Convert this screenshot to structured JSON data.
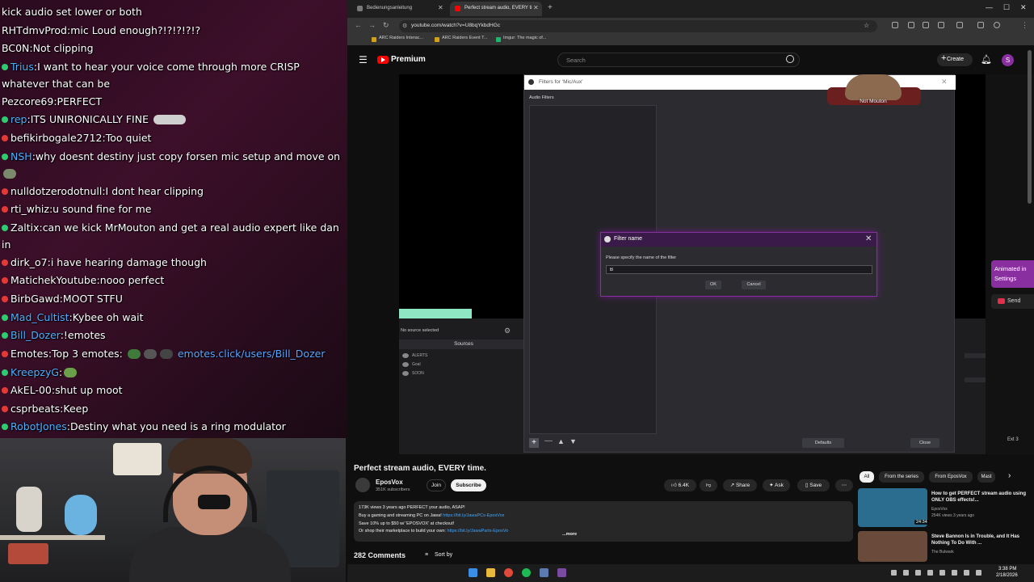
{
  "chat": {
    "lines": [
      {
        "user": "",
        "text": "kick audio set lower or both"
      },
      {
        "user": "RHTdmvProd",
        "text": "mic Loud enough?!?!?!?!?"
      },
      {
        "user": "BC0N",
        "text": "Not clipping"
      },
      {
        "user": "Trius",
        "text": "I want to hear your voice come through more CRISP whatever that can be"
      },
      {
        "user": "Pezcore69",
        "text": "PERFECT"
      },
      {
        "user": "rep",
        "text": "ITS UNIRONICALLY FINE"
      },
      {
        "user": "befikirbogale2712",
        "text": "Too quiet"
      },
      {
        "user": "NSH",
        "text": "why doesnt destiny just copy forsen mic setup and move on"
      },
      {
        "user": "nulldotzerodotnull",
        "text": "I dont hear clipping"
      },
      {
        "user": "rti_whiz",
        "text": "u sound fine for me"
      },
      {
        "user": "Zaltix",
        "text": "can we kick MrMouton and get a real audio expert like dan in"
      },
      {
        "user": "dirk_o7",
        "text": "i have hearing damage though"
      },
      {
        "user": "MatichekYoutube",
        "text": "nooo perfect"
      },
      {
        "user": "BirbGawd",
        "text": "MOOT STFU"
      },
      {
        "user": "Mad_Cultist",
        "text": "Kybee oh wait"
      },
      {
        "user": "Bill_Dozer",
        "text": "!emotes"
      },
      {
        "user": "Emotes",
        "text": "Top 3 emotes:",
        "link": "emotes.click/users/Bill_Dozer"
      },
      {
        "user": "KreepzyG",
        "text": ""
      },
      {
        "user": "AkEL-00",
        "text": "shut up moot"
      },
      {
        "user": "csprbeats",
        "text": "Keep"
      },
      {
        "user": "RobotJones",
        "text": "Destiny what you need is a ring modulator"
      }
    ]
  },
  "browser": {
    "tabs": [
      {
        "label": "Bedienungsanleitung",
        "favicon_color": "#7a7a7a"
      },
      {
        "label": "Perfect stream audio, EVERY ti",
        "favicon_color": "#ff0000"
      }
    ],
    "new_tab": "+",
    "url": "youtube.com/watch?v=U8bqYkbdHGc",
    "bookmarks": [
      {
        "label": "ARC Raiders Interac...",
        "color": "#d4a017"
      },
      {
        "label": "ARC Raiders Event T...",
        "color": "#d4a017"
      },
      {
        "label": "Imgur: The magic of...",
        "color": "#1bb76e"
      }
    ]
  },
  "youtube": {
    "brand": "Premium",
    "search_placeholder": "Search",
    "create_label": "Create",
    "avatar_letter": "S",
    "video_title": "Perfect stream audio, EVERY time.",
    "channel_name": "EposVox",
    "channel_subs": "351K subscribers",
    "join_label": "Join",
    "subscribe_label": "Subscribe",
    "likes": "6.4K",
    "share_label": "Share",
    "ask_label": "Ask",
    "save_label": "Save",
    "description": {
      "stats": "173K views  3 years ago  PERFECT your audio, ASAP!",
      "line2_text": "Buy a gaming and streaming PC on Jawa! ",
      "line2_link": "https://bit.ly/JawaPCs-EposVox",
      "line3": "Save 10% up to $50 w/ 'EPOSVOX' at checkout!",
      "line4_text": "Or shop their marketplace to build your own: ",
      "line4_link": "https://bit.ly/JawaParts-EposVo",
      "more": "...more"
    },
    "comments_count": "282 Comments",
    "sort_label": "Sort by",
    "chips": [
      {
        "label": "All",
        "active": true
      },
      {
        "label": "From the series",
        "active": false
      },
      {
        "label": "From EposVox",
        "active": false
      },
      {
        "label": "Mast",
        "active": false
      }
    ],
    "related": [
      {
        "title": "How to get PERFECT stream audio using ONLY OBS effects!...",
        "channel": "EposVox",
        "meta": "254K views  3 years ago",
        "duration": "24:34",
        "thumb_color": "#2b6d8f"
      },
      {
        "title": "Steve Bannon Is in Trouble, and It Has Nothing To Do With ...",
        "channel": "The Bulwark",
        "meta": "",
        "duration": "",
        "thumb_color": "#6a4a3a"
      }
    ]
  },
  "obs": {
    "filters_window_title": "Filters for 'Mic/Aux'",
    "audio_filters_label": "Audio Filters",
    "no_source": "No source selected",
    "sources_title": "Sources",
    "sources": [
      "ALERTS",
      "Goal",
      "SOON"
    ],
    "defaults_label": "Defaults",
    "close_label": "Close",
    "dialog": {
      "title": "Filter name",
      "prompt": "Please specify the name of the filter",
      "input_value": "B",
      "ok_label": "OK",
      "cancel_label": "Cancel"
    }
  },
  "overlay": {
    "avatar_label": "Not Mouton",
    "animated_label": "Animated in Settings",
    "send_label": "Send",
    "channel_tag": "Ext 3"
  },
  "taskbar": {
    "time": "3:38 PM",
    "date": "2/18/2026"
  }
}
